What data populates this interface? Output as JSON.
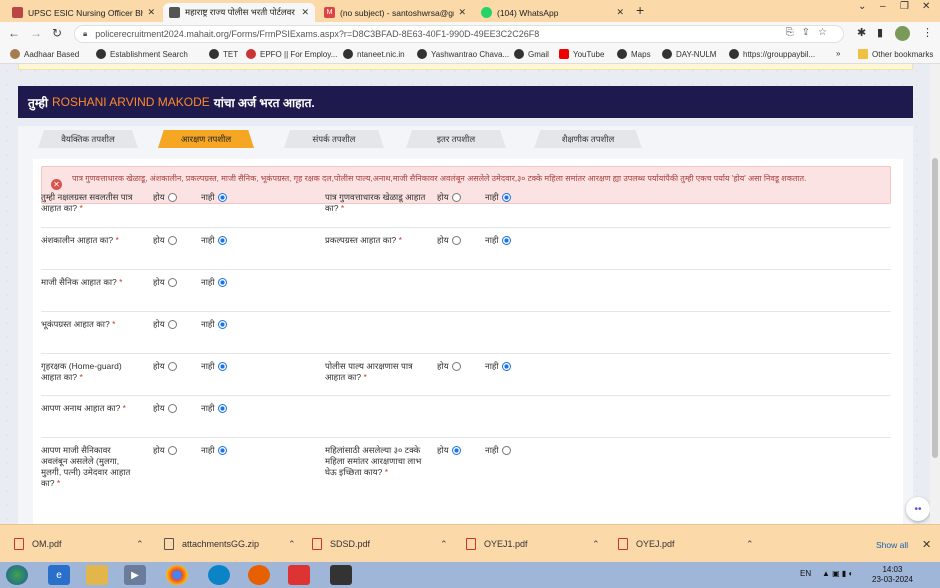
{
  "browser": {
    "tabs": [
      {
        "title": "UPSC ESIC Nursing Officer Bharti",
        "active": false,
        "favicon": "doc-icon"
      },
      {
        "title": "महाराष्ट्र राज्य पोलीस भरती पोर्टलवर आ",
        "active": true,
        "favicon": "police-icon"
      },
      {
        "title": "(no subject) - santoshwrsa@gmail",
        "active": false,
        "favicon": "gmail-icon"
      },
      {
        "title": "(104) WhatsApp",
        "active": false,
        "favicon": "whatsapp-icon"
      }
    ],
    "url": "policerecruitment2024.mahait.org/Forms/FrmPSIExams.aspx?r=D8C3BFAD-8E63-40F1-990D-49EE3C2C26F8",
    "bookmarks": [
      "Aadhaar Based",
      "Establishment Search",
      "TET",
      "EPFO || For Employ...",
      "ntaneet.nic.in",
      "Yashwantrao Chava...",
      "Gmail",
      "YouTube",
      "Maps",
      "DAY-NULM",
      "https://grouppaybil..."
    ],
    "other_bookmarks": "Other bookmarks"
  },
  "page": {
    "banner_prefix": "तुम्ही",
    "banner_name": "ROSHANI ARVIND MAKODE",
    "banner_suffix": "यांचा अर्ज भरत आहात.",
    "steps": [
      "वैयक्तिक तपशील",
      "आरक्षण तपशील",
      "संपर्क तपशील",
      "इतर तपशील",
      "शैक्षणीक तपशील"
    ],
    "active_step": 1,
    "alert_text": "पात्र गुणवत्ताधारक खेळाडू, अंशकालीन, प्रकल्पग्रस्त, माजी सैनिक, भूकंपग्रस्त, गृह रक्षक दल,पोलीस पाल्य,अनाथ,माजी सैनिकावर अवलंबून असलेले उमेदवार,३० टक्के महिला समांतर आरक्षण ह्या उपलब्ध पर्यायांपैकी तुम्ही एकच पर्याय 'होय' असा निवडू शकतात.",
    "yes_label": "होय",
    "no_label": "नाही",
    "questions": [
      {
        "q1": "तुम्ही नक्षलग्रस्त सवलतीस पात्र आहात का?",
        "a1": "no",
        "q2": "पात्र गुणवत्ताधारक खेळाडू आहात का?",
        "a2": "no"
      },
      {
        "q1": "अंशकालीन आहात का?",
        "a1": "no",
        "q2": "प्रकल्पग्रस्त आहात का?",
        "a2": "no"
      },
      {
        "q1": "माजी सैनिक आहात का?",
        "a1": "no",
        "q2": "",
        "a2": ""
      },
      {
        "q1": "भूकंपग्रस्त आहात का?",
        "a1": "no",
        "q2": "",
        "a2": ""
      },
      {
        "q1": "गृहरक्षक (Home-guard) आहात का?",
        "a1": "no",
        "q2": "पोलीस पाल्य आरक्षणास पात्र आहात का?",
        "a2": "no"
      },
      {
        "q1": "आपण अनाथ आहात का?",
        "a1": "no",
        "q2": "",
        "a2": ""
      },
      {
        "q1": "आपण माजी सैनिकावर अवलंबून असलेले (मुलगा, मुलगी, पत्नी) उमेदवार आहात का?",
        "a1": "no",
        "q2": "महिलांसाठी असलेल्या ३० टक्के महिला समांतर आरक्षणाचा लाभ घेऊ इच्छिता काय?",
        "a2": "yes"
      }
    ]
  },
  "downloads": [
    "OM.pdf",
    "attachmentsGG.zip",
    "SDSD.pdf",
    "OYEJ1.pdf",
    "OYEJ.pdf"
  ],
  "show_all": "Show all",
  "taskbar": {
    "lang": "EN",
    "time": "14:03",
    "date": "23-03-2024"
  }
}
